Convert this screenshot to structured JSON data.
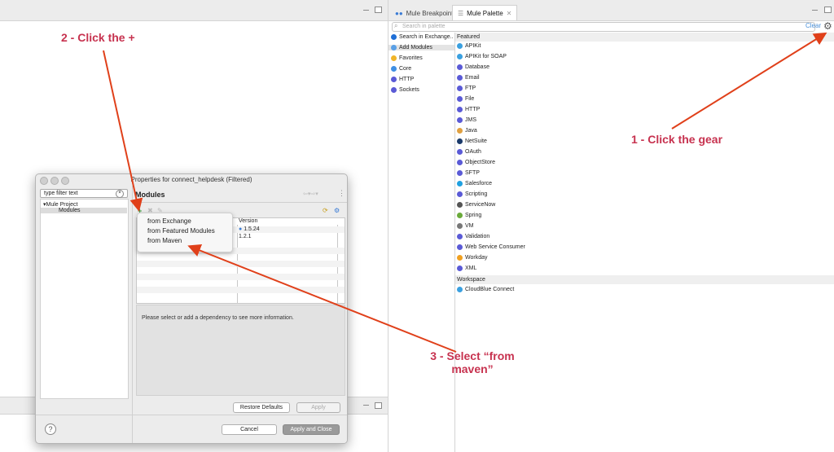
{
  "tabs": {
    "breakpoints": "Mule Breakpoints",
    "palette": "Mule Palette"
  },
  "palette": {
    "search_placeholder": "Search in palette",
    "clear": "Clear",
    "categories": [
      {
        "label": "Search in Exchange..",
        "icon": "exchange-icon",
        "color": "#1f6fd6"
      },
      {
        "label": "Add Modules",
        "icon": "add-icon",
        "color": "#5aa0e6"
      },
      {
        "label": "Favorites",
        "icon": "star-icon",
        "color": "#f0b429"
      },
      {
        "label": "Core",
        "icon": "core-icon",
        "color": "#3f8fe3"
      },
      {
        "label": "HTTP",
        "icon": "http-icon",
        "color": "#5a5ad6"
      },
      {
        "label": "Sockets",
        "icon": "sockets-icon",
        "color": "#5a5ad6"
      }
    ],
    "featured_label": "Featured",
    "modules": [
      {
        "label": "APIKit",
        "color": "#3aa0e0"
      },
      {
        "label": "APIKit for SOAP",
        "color": "#3aa0e0"
      },
      {
        "label": "Database",
        "color": "#5a5ad6"
      },
      {
        "label": "Email",
        "color": "#5a5ad6"
      },
      {
        "label": "FTP",
        "color": "#5a5ad6"
      },
      {
        "label": "File",
        "color": "#5a5ad6"
      },
      {
        "label": "HTTP",
        "color": "#5a5ad6"
      },
      {
        "label": "JMS",
        "color": "#5a5ad6"
      },
      {
        "label": "Java",
        "color": "#e0a040"
      },
      {
        "label": "NetSuite",
        "color": "#1a3a6a"
      },
      {
        "label": "OAuth",
        "color": "#5a5ad6"
      },
      {
        "label": "ObjectStore",
        "color": "#5a5ad6"
      },
      {
        "label": "SFTP",
        "color": "#5a5ad6"
      },
      {
        "label": "Salesforce",
        "color": "#1fa0e0"
      },
      {
        "label": "Scripting",
        "color": "#5a5ad6"
      },
      {
        "label": "ServiceNow",
        "color": "#555555"
      },
      {
        "label": "Spring",
        "color": "#6aaa3a"
      },
      {
        "label": "VM",
        "color": "#777777"
      },
      {
        "label": "Validation",
        "color": "#5a5ad6"
      },
      {
        "label": "Web Service Consumer",
        "color": "#5a5ad6"
      },
      {
        "label": "Workday",
        "color": "#f0a020"
      },
      {
        "label": "XML",
        "color": "#5a5ad6"
      }
    ],
    "workspace_label": "Workspace",
    "workspace_modules": [
      {
        "label": "CloudBlue Connect",
        "color": "#3aa0e0"
      }
    ]
  },
  "dialog": {
    "title": "Properties for connect_helpdesk (Filtered)",
    "filter_value": "type filter text",
    "tree": {
      "project": "Mule Project",
      "child": "Modules"
    },
    "section_title": "Modules",
    "table": {
      "version_header": "Version",
      "versions": [
        "1.5.24",
        "1.2.1"
      ]
    },
    "menu": [
      "from Exchange",
      "from Featured Modules",
      "from Maven"
    ],
    "info_text": "Please select or add a dependency to see more information.",
    "buttons": {
      "restore": "Restore Defaults",
      "apply": "Apply",
      "cancel": "Cancel",
      "apply_close": "Apply and Close"
    }
  },
  "annotations": {
    "step1": "1 - Click the gear",
    "step2": "2 - Click the +",
    "step3_line1": "3 - Select “from",
    "step3_line2": "maven”",
    "color": "#c7324f"
  }
}
